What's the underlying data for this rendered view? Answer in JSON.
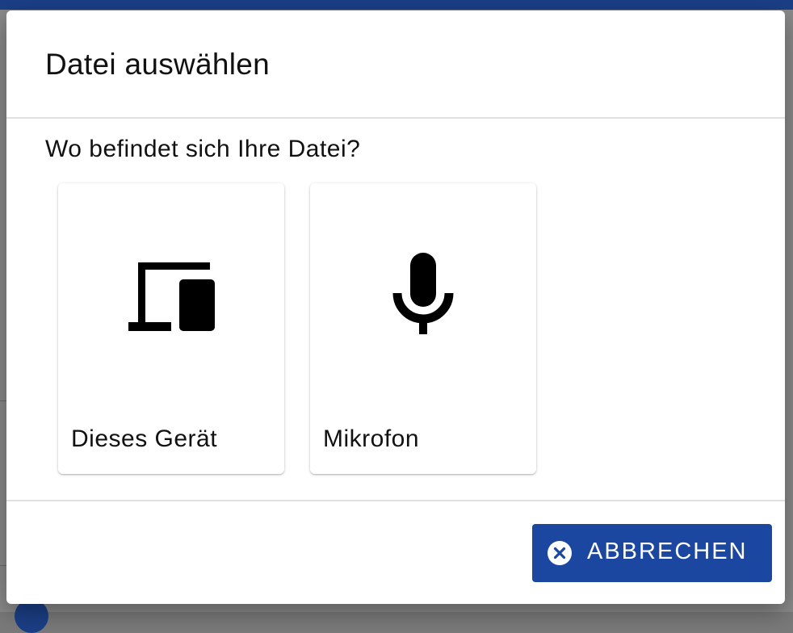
{
  "dialog": {
    "title": "Datei auswählen",
    "question": "Wo befindet sich Ihre Datei?",
    "options": [
      {
        "label": "Dieses Gerät",
        "icon": "devices-icon"
      },
      {
        "label": "Mikrofon",
        "icon": "microphone-icon"
      }
    ],
    "cancel_label": "ABBRECHEN",
    "cancel_icon": "cancel-circle-icon"
  },
  "colors": {
    "primary": "#1b47a1",
    "top_bar": "#1b3f86",
    "icon": "#000000"
  }
}
